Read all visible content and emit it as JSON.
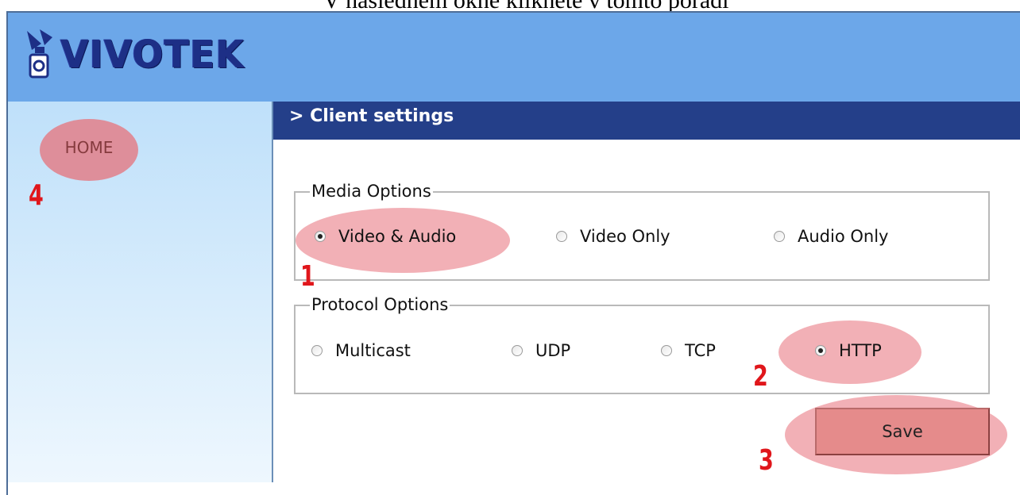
{
  "caption": "V následném okně klikněte v tomto pořadí",
  "app": {
    "logo_text": "VIVOTEK"
  },
  "sidebar": {
    "home_label": "HOME"
  },
  "page": {
    "title": "> Client settings"
  },
  "media_options": {
    "legend": "Media Options",
    "options": [
      "Video & Audio",
      "Video Only",
      "Audio Only"
    ],
    "selected": "Video & Audio"
  },
  "protocol_options": {
    "legend": "Protocol Options",
    "options": [
      "Multicast",
      "UDP",
      "TCP",
      "HTTP"
    ],
    "selected": "HTTP"
  },
  "save_label": "Save",
  "annotations": {
    "step1": "1",
    "step2": "2",
    "step3": "3",
    "step4": "4"
  },
  "colors": {
    "header": "#6ca7e9",
    "titlebar": "#243f89",
    "logo": "#1d2f86",
    "highlight": "#e8707a",
    "annotation": "#e0161b"
  }
}
